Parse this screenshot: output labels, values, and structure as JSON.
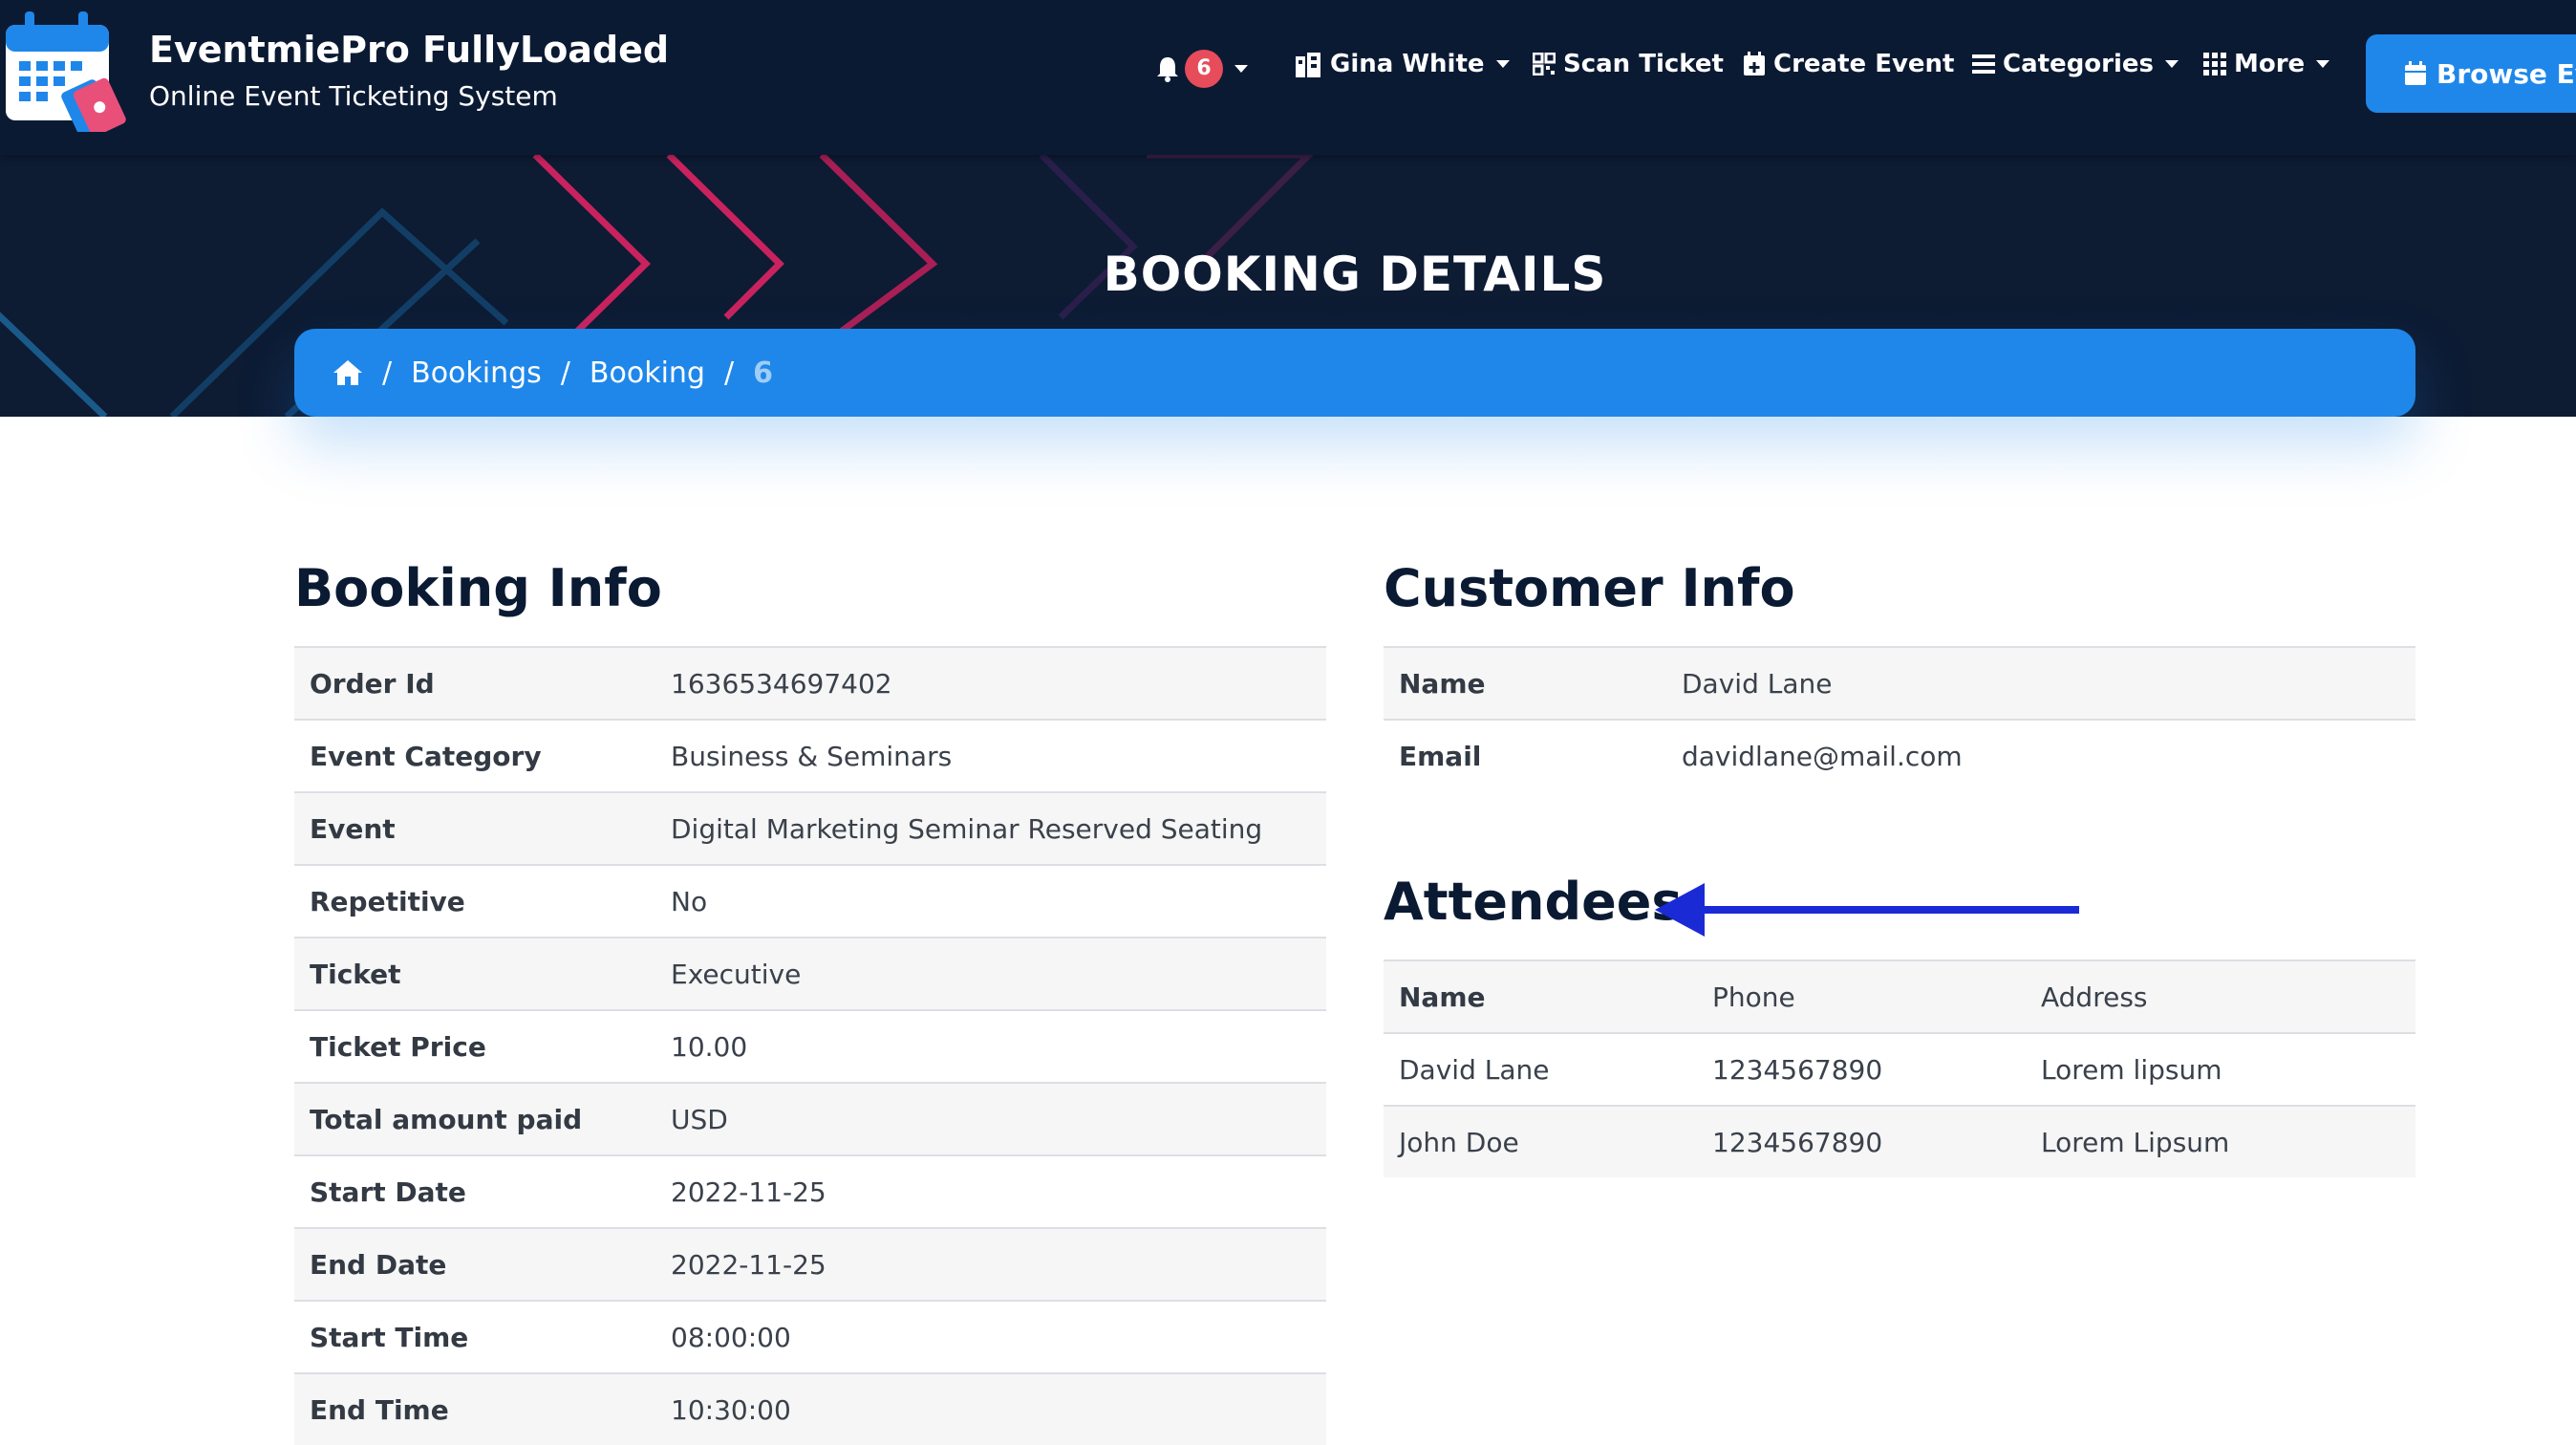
{
  "header": {
    "brand_title": "EventmiePro FullyLoaded",
    "brand_subtitle": "Online Event Ticketing System",
    "notifications_count": "6",
    "user_name": "Gina White",
    "scan_ticket": "Scan Ticket",
    "create_event": "Create Event",
    "categories": "Categories",
    "more": "More",
    "browse_events": "Browse Ev"
  },
  "hero": {
    "title": "BOOKING DETAILS",
    "breadcrumb": [
      "Bookings",
      "Booking",
      "6"
    ]
  },
  "booking_info": {
    "heading": "Booking Info",
    "rows": [
      {
        "label": "Order Id",
        "value": "1636534697402"
      },
      {
        "label": "Event Category",
        "value": "Business & Seminars"
      },
      {
        "label": "Event",
        "value": "Digital Marketing Seminar Reserved Seating"
      },
      {
        "label": "Repetitive",
        "value": "No"
      },
      {
        "label": "Ticket",
        "value": "Executive"
      },
      {
        "label": "Ticket Price",
        "value": "10.00"
      },
      {
        "label": "Total amount paid",
        "value": "USD"
      },
      {
        "label": "Start Date",
        "value": "2022-11-25"
      },
      {
        "label": "End Date",
        "value": "2022-11-25"
      },
      {
        "label": "Start Time",
        "value": "08:00:00"
      },
      {
        "label": "End Time",
        "value": "10:30:00"
      }
    ]
  },
  "customer_info": {
    "heading": "Customer Info",
    "rows": [
      {
        "label": "Name",
        "value": "David Lane"
      },
      {
        "label": "Email",
        "value": "davidlane@mail.com"
      }
    ]
  },
  "attendees": {
    "heading": "Attendees",
    "columns": [
      "Name",
      "Phone",
      "Address"
    ],
    "rows": [
      [
        "David Lane",
        "1234567890",
        "Lorem lipsum"
      ],
      [
        "John Doe",
        "1234567890",
        "Lorem Lipsum"
      ]
    ]
  },
  "colors": {
    "navy": "#0b1a33",
    "accent_blue": "#1f87ea",
    "badge_red": "#e74c5b",
    "annotation_arrow": "#1a2bd6"
  }
}
